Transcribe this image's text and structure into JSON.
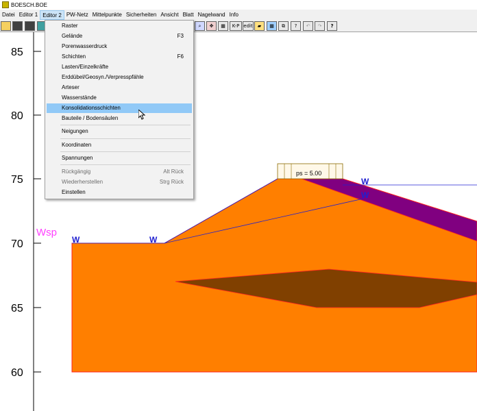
{
  "window": {
    "title": "BOESCH.BOE"
  },
  "menubar": {
    "items": [
      "Datei",
      "Editor 1",
      "Editor 2",
      "PW-Netz",
      "Mittelpunkte",
      "Sicherheiten",
      "Ansicht",
      "Blatt",
      "Nagelwand",
      "Info"
    ],
    "active": "Editor 2"
  },
  "toolbar": {
    "left_icons": [
      "open-folder-icon",
      "save-icon",
      "save-as-icon",
      "copy-icon"
    ],
    "right_buttons": [
      "zoom-icon",
      "pan-icon",
      "grid-icon",
      "K-P",
      "edit",
      "layer-icon",
      "table-icon",
      "window-icon",
      "?",
      "undo-icon",
      "redo-icon",
      "?"
    ],
    "kp_label": "K-P",
    "edit_label": "edit",
    "q1_label": "?",
    "q2_label": "?"
  },
  "dropdown": {
    "items": [
      {
        "label": "Raster",
        "shortcut": ""
      },
      {
        "label": "Gelände",
        "shortcut": "F3"
      },
      {
        "label": "Porenwasserdruck",
        "shortcut": ""
      },
      {
        "label": "Schichten",
        "shortcut": "F6"
      },
      {
        "label": "Lasten/Einzelkräfte",
        "shortcut": ""
      },
      {
        "label": "Erddübel/Geosyn./Verpresspfähle",
        "shortcut": ""
      },
      {
        "label": "Arteser",
        "shortcut": ""
      },
      {
        "label": "Wasserstände",
        "shortcut": ""
      },
      {
        "label": "Konsolidationsschichten",
        "shortcut": "",
        "highlighted": true
      },
      {
        "label": "Bauteile / Bodensäulen",
        "shortcut": ""
      },
      {
        "label": "Neigungen",
        "shortcut": ""
      },
      {
        "label": "Koordinaten",
        "shortcut": ""
      },
      {
        "label": "Spannungen",
        "shortcut": ""
      },
      {
        "label": "Rückgängig",
        "shortcut": "Alt Rück",
        "disabled": true
      },
      {
        "label": "Wiederherstellen",
        "shortcut": "Strg Rück",
        "disabled": true
      },
      {
        "label": "Einstellen",
        "shortcut": ""
      }
    ]
  },
  "drawing": {
    "y_ticks": [
      "85",
      "80",
      "75",
      "70",
      "65",
      "60"
    ],
    "water_label": "Wsp",
    "w_markers": [
      "W",
      "W",
      "W",
      "W"
    ],
    "load_label": "ps = 5.00",
    "colors": {
      "soil": "#ff7f00",
      "lens": "#804000",
      "layer": "#800080",
      "line": "#2020d0",
      "water_label": "#ff40ff"
    }
  }
}
